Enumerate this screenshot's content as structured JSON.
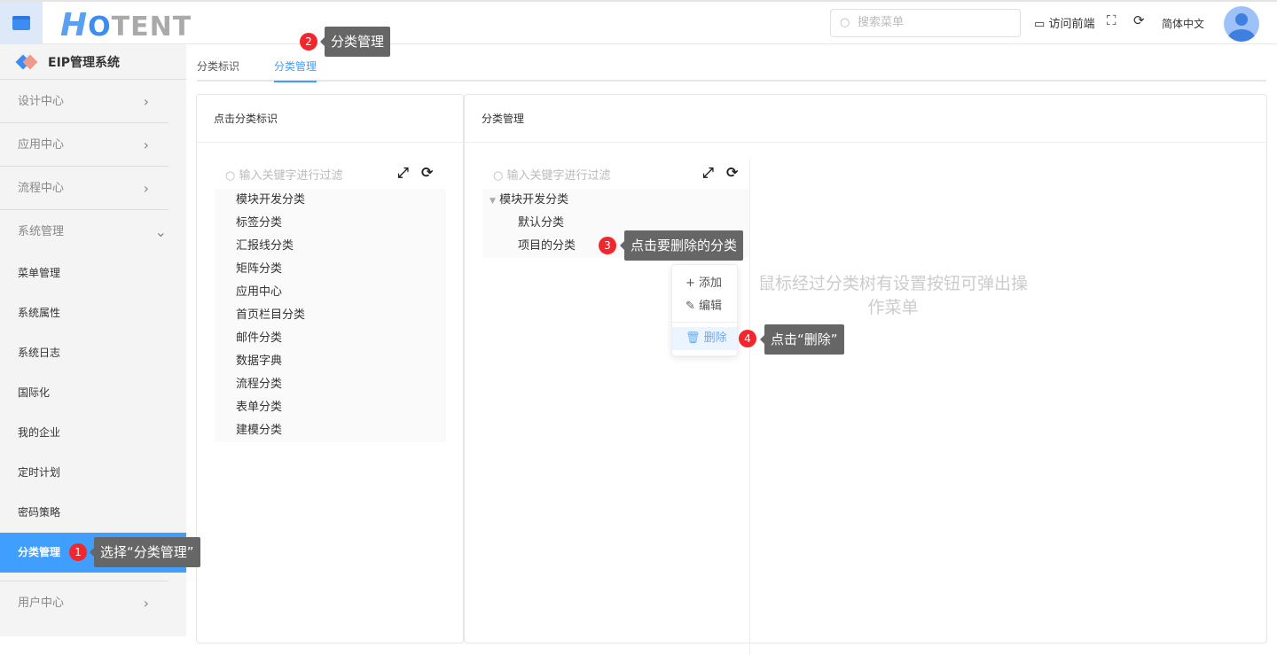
{
  "header": {
    "logo": "HOTENT",
    "search_placeholder": "搜索菜单",
    "visit_frontend": "访问前端",
    "language": "简体中文"
  },
  "sidebar": {
    "brand": "EIP管理系统",
    "groups": [
      "设计中心",
      "应用中心",
      "流程中心",
      "系统管理",
      "用户中心"
    ],
    "items": [
      "菜单管理",
      "系统属性",
      "系统日志",
      "国际化",
      "我的企业",
      "定时计划",
      "密码策略",
      "分类管理"
    ],
    "active": "分类管理"
  },
  "tabs": [
    "分类标识",
    "分类管理"
  ],
  "left_panel": {
    "title": "点击分类标识",
    "filter_placeholder": "输入关键字进行过滤",
    "nodes": [
      "模块开发分类",
      "标签分类",
      "汇报线分类",
      "矩阵分类",
      "应用中心",
      "首页栏目分类",
      "邮件分类",
      "数据字典",
      "流程分类",
      "表单分类",
      "建模分类"
    ]
  },
  "right_panel": {
    "title": "分类管理",
    "filter_placeholder": "输入关键字进行过滤",
    "root": "模块开发分类",
    "children": [
      "默认分类",
      "项目的分类"
    ],
    "context_menu": [
      "添加",
      "编辑",
      "删除"
    ],
    "hint": "鼠标经过分类树有设置按钮可弹出操作菜单"
  },
  "callouts": [
    {
      "n": "1",
      "text": "选择“分类管理”"
    },
    {
      "n": "2",
      "text": "分类管理"
    },
    {
      "n": "3",
      "text": "点击要删除的分类"
    },
    {
      "n": "4",
      "text": "点击“删除”"
    }
  ]
}
